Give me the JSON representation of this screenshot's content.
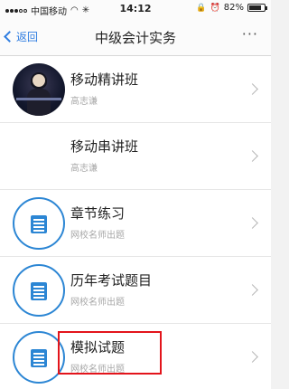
{
  "status_bar": {
    "carrier": "中国移动",
    "time": "14:12",
    "battery_text": "82%",
    "battery_level": 0.82,
    "signal_bars_filled": 3,
    "signal_bars_total": 5
  },
  "nav": {
    "back_label": "返回",
    "title": "中级会计实务",
    "more_label": "···"
  },
  "items": [
    {
      "title": "移动精讲班",
      "subtitle": "高志谦",
      "icon": "video-thumbnail"
    },
    {
      "title": "移动串讲班",
      "subtitle": "高志谦",
      "icon": "none"
    },
    {
      "title": "章节练习",
      "subtitle": "网校名师出题",
      "icon": "document-icon"
    },
    {
      "title": "历年考试题目",
      "subtitle": "网校名师出题",
      "icon": "document-icon"
    },
    {
      "title": "模拟试题",
      "subtitle": "网校名师出题",
      "icon": "document-icon",
      "highlighted": true
    }
  ],
  "colors": {
    "accent": "#2f7de1",
    "icon_blue": "#2c86d4",
    "highlight_red": "#e3141b"
  }
}
